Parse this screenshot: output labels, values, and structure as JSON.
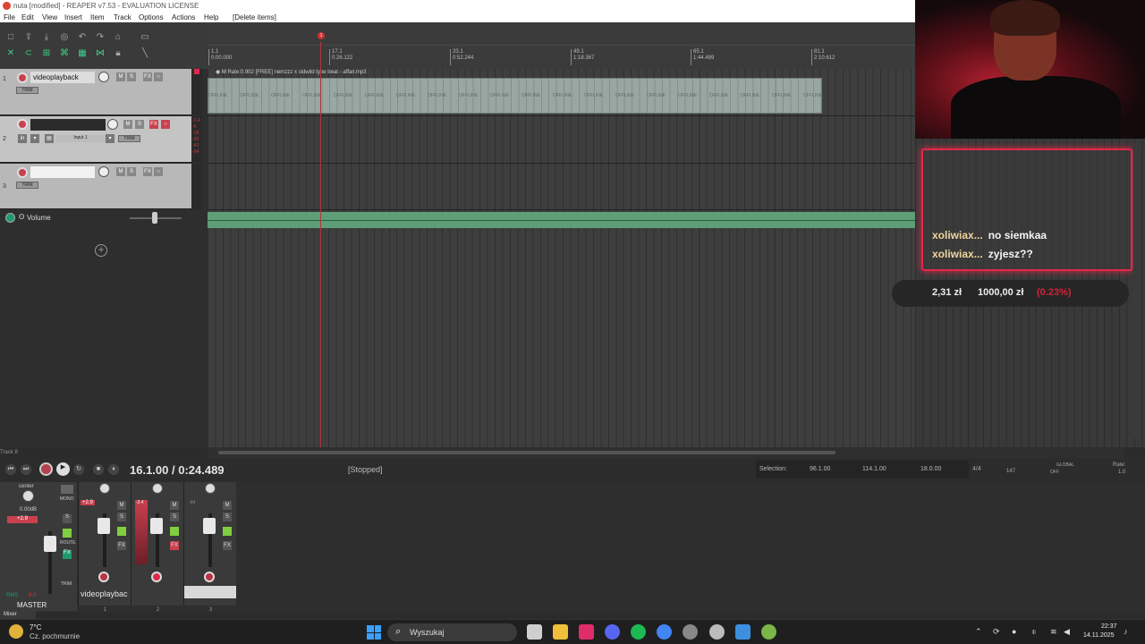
{
  "window": {
    "title": "nuta [modified] - REAPER v7.53 - EVALUATION LICENSE",
    "menus": [
      "File",
      "Edit",
      "View",
      "Insert",
      "Item",
      "Track",
      "Options",
      "Actions",
      "Help",
      "[Delete items]"
    ]
  },
  "ruler": {
    "marks": [
      {
        "bar": "1.1",
        "time": "0:00.000"
      },
      {
        "bar": "17.1",
        "time": "0:26.122"
      },
      {
        "bar": "33.1",
        "time": "0:52.244"
      },
      {
        "bar": "49.1",
        "time": "1:18.367"
      },
      {
        "bar": "65.1",
        "time": "1:44.489"
      },
      {
        "bar": "81.1",
        "time": "2:10.612"
      }
    ],
    "cursor_marker": "1"
  },
  "tracks": [
    {
      "number": "1",
      "name": "videoplayback",
      "trim": "TRIM"
    },
    {
      "number": "2",
      "name": "",
      "input": "Input 1",
      "in_label": "in",
      "trim": "TRIM"
    },
    {
      "number": "3",
      "name": "",
      "trim": "TRIM"
    }
  ],
  "track_buttons": {
    "mute": "M",
    "solo": "S",
    "fx": "FX"
  },
  "meter_ticks": [
    "-3.4",
    "-6",
    "-18",
    "-30",
    "-42",
    "-54"
  ],
  "envelope": {
    "label": "Volume"
  },
  "item": {
    "header": "Rate:0.902 [FREE] nemzzz x sidwild type beat - affair.mp3",
    "offline_label": "OFFLINE",
    "offline_count": 20
  },
  "transport": {
    "time": "16.1.00 / 0:24.489",
    "state": "[Stopped]",
    "selection_label": "Selection:",
    "selection_start": "96.1.00",
    "selection_end": "114.1.00",
    "selection_length": "18.0.00",
    "time_sig": "4/4",
    "bpm": "147",
    "global": "GLOBAL",
    "global_state": "OFF",
    "rate_label": "Rate:",
    "rate_value": "1.0",
    "track_label": "Track 8"
  },
  "mixer": {
    "master_label": "MASTER",
    "center": "center",
    "master_db": "0.00dB",
    "master_peak": "+2.9",
    "rms": "RMS",
    "rms_value": "-3.0",
    "mono": "MONO",
    "route": "ROUTE",
    "fx": "FX",
    "trim": "TRIM",
    "strips": [
      {
        "name": "videoplaybac",
        "index": "1",
        "peak": "+2.9"
      },
      {
        "name": "",
        "index": "2",
        "peak": "-3.4"
      },
      {
        "name": "",
        "index": "3",
        "peak": "-inf"
      }
    ],
    "label": "Mixer"
  },
  "chat": {
    "messages": [
      {
        "user": "xoliwiax...",
        "text": "no siemkaa"
      },
      {
        "user": "xoliwiax...",
        "text": "zyjesz??"
      }
    ],
    "goal_current": "2,31 zł",
    "goal_target": "1000,00 zł",
    "goal_percent": "(0.23%)",
    "goal_fraction": 0.0023
  },
  "taskbar": {
    "weather_temp": "7°C",
    "weather_desc": "Cz. pochmurnie",
    "search_placeholder": "Wyszukaj",
    "time": "22:37",
    "date": "14.11.2025"
  },
  "colors": {
    "accent_red": "#e0284a",
    "envelope_green": "#5e9f78",
    "item_gray": "#9aa6a2",
    "chat_user": "#f0d49c"
  }
}
